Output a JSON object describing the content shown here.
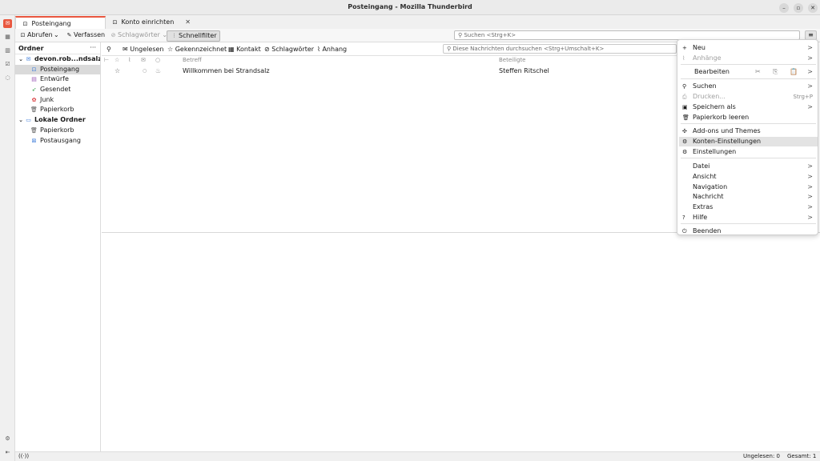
{
  "window": {
    "title": "Posteingang - Mozilla Thunderbird",
    "controls": {
      "minimize": "–",
      "maximize": "▫",
      "close": "✕"
    }
  },
  "tabs": [
    {
      "label": "Posteingang",
      "icon": "inbox-icon",
      "active": true
    },
    {
      "label": "Konto einrichten",
      "icon": "account-icon",
      "close": "✕"
    }
  ],
  "toolbar": {
    "get_messages": "Abrufen",
    "dropdown": "⌄",
    "compose": "Verfassen",
    "tags": "Schlagwörter",
    "quick_filter": "Schnellfilter",
    "search_placeholder": "Suchen <Strg+K>",
    "menu_icon": "≡"
  },
  "folder_pane": {
    "header": "Ordner",
    "more": "···",
    "folders": [
      {
        "label": "devon.rob...ndsalz.de",
        "icon": "✉",
        "twisty": "⌄",
        "level": 0,
        "bold": true,
        "color": "#3b7ad8"
      },
      {
        "label": "Posteingang",
        "icon": "⊡",
        "level": 1,
        "selected": true,
        "color": "#3b7ad8"
      },
      {
        "label": "Entwürfe",
        "icon": "▤",
        "level": 1,
        "color": "#9b59b6"
      },
      {
        "label": "Gesendet",
        "icon": "➶",
        "level": 1,
        "color": "#2e9e44"
      },
      {
        "label": "Junk",
        "icon": "✿",
        "level": 1,
        "color": "#d9383b"
      },
      {
        "label": "Papierkorb",
        "icon": "🗑",
        "level": 1,
        "color": "#555555"
      },
      {
        "label": "Lokale Ordner",
        "icon": "▭",
        "twisty": "⌄",
        "level": 0,
        "bold": true,
        "color": "#3b7ad8"
      },
      {
        "label": "Papierkorb",
        "icon": "🗑",
        "level": 1,
        "color": "#555555"
      },
      {
        "label": "Postausgang",
        "icon": "⊠",
        "level": 1,
        "color": "#3b7ad8"
      }
    ]
  },
  "quick_filter_bar": {
    "pin": "⚲",
    "unread": "Ungelesen",
    "starred": "Gekennzeichnet",
    "contact": "Kontakt",
    "tags": "Schlagwörter",
    "attachment": "Anhang",
    "search_placeholder": "Diese Nachrichten durchsuchen <Strg+Umschalt+K>"
  },
  "thread_pane": {
    "columns": {
      "subject": "Betreff",
      "correspondents": "Beteiligte"
    },
    "messages": [
      {
        "subject": "Willkommen bei Strandsalz",
        "correspondent": "Steffen Ritschel",
        "star": "☆",
        "status": "○",
        "junk": "🜁"
      }
    ]
  },
  "status_bar": {
    "activity_icon": "((·))",
    "unread": "Ungelesen: 0",
    "total": "Gesamt: 1"
  },
  "app_menu": {
    "items": [
      {
        "key": "new",
        "label": "Neu",
        "icon": "+",
        "submenu": true
      },
      {
        "key": "attachments",
        "label": "Anhänge",
        "icon": "⌇",
        "submenu": true,
        "disabled": true
      },
      {
        "key": "edit",
        "label": "Bearbeiten",
        "submenu": true,
        "edit_row": true
      },
      {
        "key": "find",
        "label": "Suchen",
        "icon": "⚲",
        "submenu": true
      },
      {
        "key": "print",
        "label": "Drucken...",
        "icon": "⎙",
        "shortcut": "Strg+P",
        "disabled": true
      },
      {
        "key": "save_as",
        "label": "Speichern als",
        "icon": "▣",
        "submenu": true
      },
      {
        "key": "empty_trash",
        "label": "Papierkorb leeren",
        "icon": "🗑"
      },
      {
        "key": "addons",
        "label": "Add-ons und Themes",
        "icon": "✣"
      },
      {
        "key": "account_settings",
        "label": "Konten-Einstellungen",
        "icon": "⚙",
        "hover": true
      },
      {
        "key": "settings",
        "label": "Einstellungen",
        "icon": "⚙"
      },
      {
        "key": "file",
        "label": "Datei",
        "submenu": true
      },
      {
        "key": "view",
        "label": "Ansicht",
        "submenu": true
      },
      {
        "key": "navigation",
        "label": "Navigation",
        "submenu": true
      },
      {
        "key": "message",
        "label": "Nachricht",
        "submenu": true
      },
      {
        "key": "extras",
        "label": "Extras",
        "submenu": true
      },
      {
        "key": "help",
        "label": "Hilfe",
        "icon": "?",
        "submenu": true
      },
      {
        "key": "quit",
        "label": "Beenden",
        "icon": "⏻"
      }
    ],
    "edit_icons": {
      "cut": "✂",
      "copy": "⎘",
      "paste": "📋"
    },
    "submenu_arrow": ">"
  },
  "colors": {
    "accent": "#e9573f",
    "folder_blue": "#3b7ad8"
  }
}
